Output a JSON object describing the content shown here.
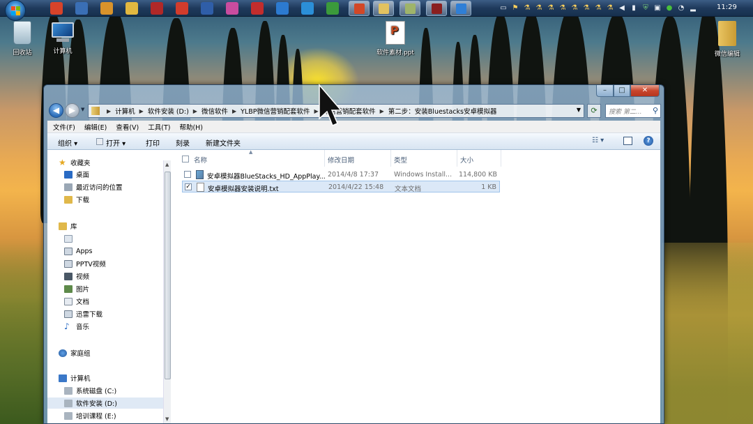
{
  "taskbar": {
    "clock": "11:29",
    "quick_launch_icons": [
      "xmind-icon",
      "qq-icon",
      "folder-icon",
      "smiley-icon",
      "media-icon",
      "app-x-icon",
      "photoshop-icon",
      "paint-icon",
      "opera-icon",
      "browser-icon",
      "ie-icon",
      "chrome-icon"
    ],
    "running_tasks": [
      "powerpoint-task",
      "explorer-task",
      "image-task",
      "media-task",
      "app-task"
    ],
    "tray_icons": [
      "monitor-icon",
      "flag-icon",
      "lab-icon",
      "lab-icon",
      "lab-icon",
      "lab-icon",
      "lab-icon",
      "lab-icon",
      "lab-icon",
      "lab-icon",
      "speaker-off-icon",
      "battery-icon",
      "shield-icon",
      "network-icon",
      "green-icon",
      "volume-icon",
      "signal-icon"
    ]
  },
  "desktop": {
    "icons": [
      {
        "label": "回收站"
      },
      {
        "label": "计算机"
      },
      {
        "label": "软件素材.ppt"
      },
      {
        "label": "微信编辑"
      }
    ]
  },
  "window": {
    "controls": {
      "minimize": "–",
      "maximize": "□",
      "close": "✕"
    },
    "nav": {
      "back": "◀",
      "forward": "▶"
    },
    "address": {
      "segments": [
        "计算机",
        "软件安装 (D:)",
        "微信软件",
        "YLBP微信营销配套软件",
        "微信营销配套软件",
        "第二步：安装Bluestacks安卓模拟器"
      ]
    },
    "search_placeholder": "搜索 第二...",
    "menubar": [
      "文件(F)",
      "编辑(E)",
      "查看(V)",
      "工具(T)",
      "帮助(H)"
    ],
    "toolbar": {
      "organize": "组织 ▾",
      "open": "打开 ▾",
      "print": "打印",
      "burn": "刻录",
      "new_folder": "新建文件夹"
    },
    "nav_pane": {
      "favorites": {
        "title": "收藏夹",
        "items": [
          "桌面",
          "最近访问的位置",
          "下载"
        ]
      },
      "libraries": {
        "title": "库",
        "items": [
          "",
          "Apps",
          "PPTV视频",
          "视频",
          "图片",
          "文档",
          "迅雷下载",
          "音乐"
        ]
      },
      "homegroup": "家庭组",
      "computer": {
        "title": "计算机",
        "items": [
          "系统磁盘 (C:)",
          "软件安装 (D:)",
          "培训课程 (E:)"
        ]
      }
    },
    "columns": {
      "name": "名称",
      "date": "修改日期",
      "type": "类型",
      "size": "大小"
    },
    "files": [
      {
        "name": "安卓模拟器BlueStacks_HD_AppPlay...",
        "date": "2014/4/8 17:37",
        "type": "Windows Install...",
        "size": "114,800 KB",
        "checked": false
      },
      {
        "name": "安卓模拟器安装说明.txt",
        "date": "2014/4/22 15:48",
        "type": "文本文档",
        "size": "1 KB",
        "checked": true
      }
    ]
  },
  "colors": {
    "taskbar": "#1f3a5c",
    "window_frame": "#8fb0d0",
    "selection": "#dbe8f7",
    "close_button": "#c8452c"
  }
}
